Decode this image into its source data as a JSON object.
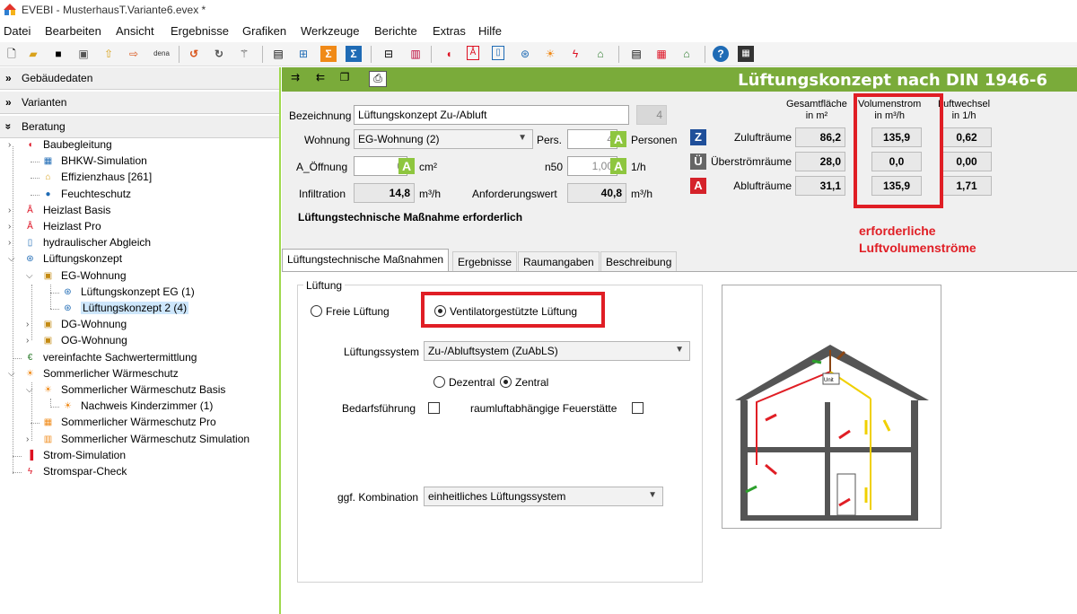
{
  "window": {
    "title": "EVEBI - MusterhausT.Variante6.evex *"
  },
  "menu": [
    "Datei",
    "Bearbeiten",
    "Ansicht",
    "Ergebnisse",
    "Grafiken",
    "Werkzeuge",
    "Berichte",
    "Extras",
    "Hilfe"
  ],
  "toolbar": {
    "dena_label": "dena"
  },
  "sidebar": {
    "sections": [
      "Gebäudedaten",
      "Varianten",
      "Beratung"
    ],
    "items": [
      {
        "label": "Baubegleitung",
        "icon": "helmet-icon"
      },
      {
        "label": "BHKW-Simulation",
        "icon": "chp-icon"
      },
      {
        "label": "Effizienzhaus [261]",
        "icon": "house-arrow-icon"
      },
      {
        "label": "Feuchteschutz",
        "icon": "droplet-icon"
      },
      {
        "label": "Heizlast Basis",
        "icon": "heat-load-icon"
      },
      {
        "label": "Heizlast Pro",
        "icon": "heat-load-pro-icon"
      },
      {
        "label": "hydraulischer Abgleich",
        "icon": "hydraulic-icon"
      },
      {
        "label": "Lüftungskonzept",
        "icon": "fan-icon"
      },
      {
        "label": "EG-Wohnung",
        "icon": "apartment-icon"
      },
      {
        "label": "Lüftungskonzept EG (1)",
        "icon": "fan-icon"
      },
      {
        "label": "Lüftungskonzept 2 (4)",
        "icon": "fan-icon"
      },
      {
        "label": "DG-Wohnung",
        "icon": "apartment-icon"
      },
      {
        "label": "OG-Wohnung",
        "icon": "apartment-icon"
      },
      {
        "label": "vereinfachte Sachwertermittlung",
        "icon": "euro-house-icon"
      },
      {
        "label": "Sommerlicher Wärmeschutz",
        "icon": "sun-icon"
      },
      {
        "label": "Sommerlicher Wärmeschutz Basis",
        "icon": "sun-icon"
      },
      {
        "label": "Nachweis Kinderzimmer (1)",
        "icon": "sun-icon"
      },
      {
        "label": "Sommerlicher Wärmeschutz Pro",
        "icon": "sun-grid-icon"
      },
      {
        "label": "Sommerlicher Wärmeschutz Simulation",
        "icon": "sun-chart-icon"
      },
      {
        "label": "Strom-Simulation",
        "icon": "power-sim-icon"
      },
      {
        "label": "Stromspar-Check",
        "icon": "lightning-icon"
      }
    ]
  },
  "header": {
    "title": "Lüftungskonzept nach DIN 1946-6"
  },
  "form": {
    "bezeichnung_label": "Bezeichnung",
    "bezeichnung_value": "Lüftungskonzept Zu-/Abluft",
    "id_value": "4",
    "wohnung_label": "Wohnung",
    "wohnung_value": "EG-Wohnung (2)",
    "pers_label": "Pers.",
    "pers_value": "4",
    "personen_label": "Personen",
    "a_oeffnung_label": "A_Öffnung",
    "a_oeffnung_value": "0",
    "a_unit": "cm²",
    "n50_label": "n50",
    "n50_value": "1,00",
    "n50_unit": "1/h",
    "infiltration_label": "Infiltration",
    "infiltration_value": "14,8",
    "infiltration_unit": "m³/h",
    "anforderung_label": "Anforderungswert",
    "anforderung_value": "40,8",
    "anforderung_unit": "m³/h",
    "massnahme_text": "Lüftungstechnische Maßnahme erforderlich",
    "a_button": "A"
  },
  "summary": {
    "col_headers": [
      "Gesamtfläche\nin m²",
      "Volumenstrom\nin m³/h",
      "Luftwechsel\nin 1/h"
    ],
    "rows": [
      {
        "badge": "Z",
        "badge_color": "#1f4f9a",
        "label": "Zulufträume",
        "area": "86,2",
        "flow": "135,9",
        "exchange": "0,62"
      },
      {
        "badge": "Ü",
        "badge_color": "#666666",
        "label": "Überströmräume",
        "area": "28,0",
        "flow": "0,0",
        "exchange": "0,00"
      },
      {
        "badge": "A",
        "badge_color": "#d5222a",
        "label": "Ablufträume",
        "area": "31,1",
        "flow": "135,9",
        "exchange": "1,71"
      }
    ],
    "annotation": "erforderliche\nLuftvolumenströme",
    "accent_red": "#e01e25"
  },
  "tabs": [
    "Lüftungstechnische Maßnahmen",
    "Ergebnisse",
    "Raumangaben",
    "Beschreibung"
  ],
  "panel": {
    "group_label": "Lüftung",
    "radio_freie": "Freie Lüftung",
    "radio_ventilator": "Ventilatorgestützte Lüftung",
    "system_label": "Lüftungssystem",
    "system_value": "Zu-/Abluftsystem (ZuAbLS)",
    "dezentral": "Dezentral",
    "zentral": "Zentral",
    "bedarf_label": "Bedarfsführung",
    "raumluft_label": "raumluftabhängige Feuerstätte",
    "kombination_label": "ggf. Kombination",
    "kombination_value": "einheitliches Lüftungssystem",
    "diagram_unit_label": "Unit"
  },
  "colors": {
    "header_green": "#7aab3a",
    "accent_green": "#8ec63f"
  }
}
